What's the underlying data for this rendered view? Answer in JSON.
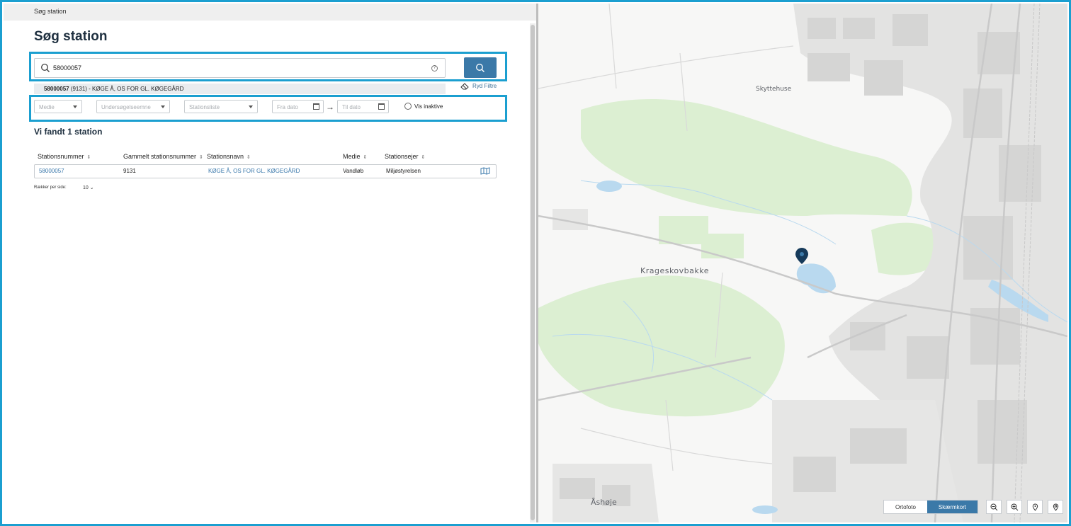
{
  "breadcrumb": "Søg station",
  "page_title": "Søg station",
  "search": {
    "value": "58000057",
    "help_label": "?"
  },
  "suggestion": {
    "number": "58000057",
    "rest": " (9131) - KØGE Å, OS FOR GL. KØGEGÅRD"
  },
  "clear_filters_label": "Ryd Filtre",
  "filters": {
    "medie": "Medie",
    "undersoegelse": "Undersøgelseemne",
    "stationsliste": "Stationsliste",
    "fra_dato": "Fra dato",
    "til_dato": "Til dato",
    "arrow": "→",
    "vis_inaktive": "Vis inaktive"
  },
  "result_title": "Vi fandt 1 station",
  "table": {
    "headers": [
      "Stationsnummer",
      "Gammelt stationsnummer",
      "Stationsnavn",
      "Medie",
      "Stationsejer"
    ],
    "sort_glyph": "⇕",
    "rows": [
      [
        "58000057",
        "9131",
        "KØGE Å, OS FOR GL. KØGEGÅRD",
        "Vandløb",
        "Miljøstyrelsen"
      ]
    ]
  },
  "pager": {
    "label": "Rækker per side:",
    "value": "10",
    "caret": "⌄"
  },
  "map": {
    "places": [
      "Skyttehuse",
      "Krageskovbakke",
      "Åshøje"
    ],
    "toggle": {
      "ortofoto": "Ortofoto",
      "skaermkort": "Skærmkort"
    }
  },
  "colors": {
    "accent": "#1b9fd0",
    "primary": "#3b79a8",
    "link": "#3a78ab",
    "forest": "#dcefd2",
    "water": "#b9d9ef",
    "built": "#dcdcdc"
  },
  "icons": [
    "search-icon",
    "help-icon",
    "eraser-icon",
    "calendar-icon",
    "map-icon",
    "map-marker-icon",
    "zoom-out-icon",
    "zoom-in-icon",
    "pin-icon",
    "location-icon"
  ]
}
